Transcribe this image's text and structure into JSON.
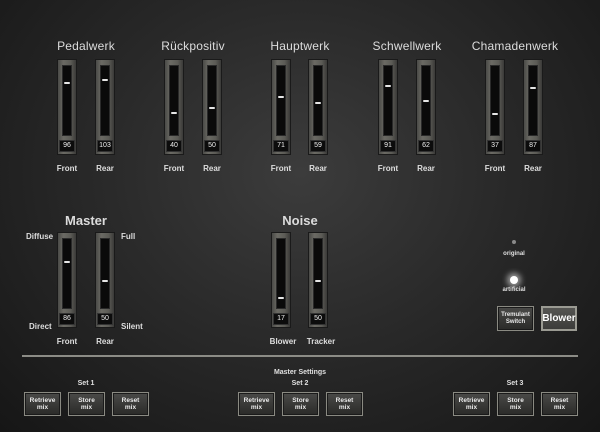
{
  "divisions": [
    {
      "title": "Pedalwerk",
      "front": 96,
      "rear": 103,
      "front_label": "Front",
      "rear_label": "Rear"
    },
    {
      "title": "Rückpositiv",
      "front": 40,
      "rear": 50,
      "front_label": "Front",
      "rear_label": "Rear"
    },
    {
      "title": "Hauptwerk",
      "front": 71,
      "rear": 59,
      "front_label": "Front",
      "rear_label": "Rear"
    },
    {
      "title": "Schwellwerk",
      "front": 91,
      "rear": 62,
      "front_label": "Front",
      "rear_label": "Rear"
    },
    {
      "title": "Chamadenwerk",
      "front": 37,
      "rear": 87,
      "front_label": "Front",
      "rear_label": "Rear"
    }
  ],
  "master": {
    "title": "Master",
    "front": 86,
    "rear": 50,
    "front_label": "Front",
    "rear_label": "Rear",
    "diffuse_label": "Diffuse",
    "direct_label": "Direct",
    "full_label": "Full",
    "silent_label": "Silent"
  },
  "noise": {
    "title": "Noise",
    "blower": 17,
    "tracker": 50,
    "blower_label": "Blower",
    "tracker_label": "Tracker"
  },
  "tremulant": {
    "option_original": "original",
    "option_artificial": "artificial",
    "selected": "artificial",
    "switch_line1": "Tremulant",
    "switch_line2": "Switch"
  },
  "blower_button": "Blower",
  "master_settings": {
    "title": "Master Settings",
    "sets": [
      {
        "label": "Set 1",
        "retrieve": [
          "Retrieve",
          "mix"
        ],
        "store": [
          "Store",
          "mix"
        ],
        "reset": [
          "Reset",
          "mix"
        ]
      },
      {
        "label": "Set 2",
        "retrieve": [
          "Retrieve",
          "mix"
        ],
        "store": [
          "Store",
          "mix"
        ],
        "reset": [
          "Reset",
          "mix"
        ]
      },
      {
        "label": "Set 3",
        "retrieve": [
          "Retrieve",
          "mix"
        ],
        "store": [
          "Store",
          "mix"
        ],
        "reset": [
          "Reset",
          "mix"
        ]
      }
    ]
  },
  "colors": {
    "accent_glow": "#ffffff",
    "panel_bg": "#2a2a2a",
    "divider": "#8c8c86"
  }
}
